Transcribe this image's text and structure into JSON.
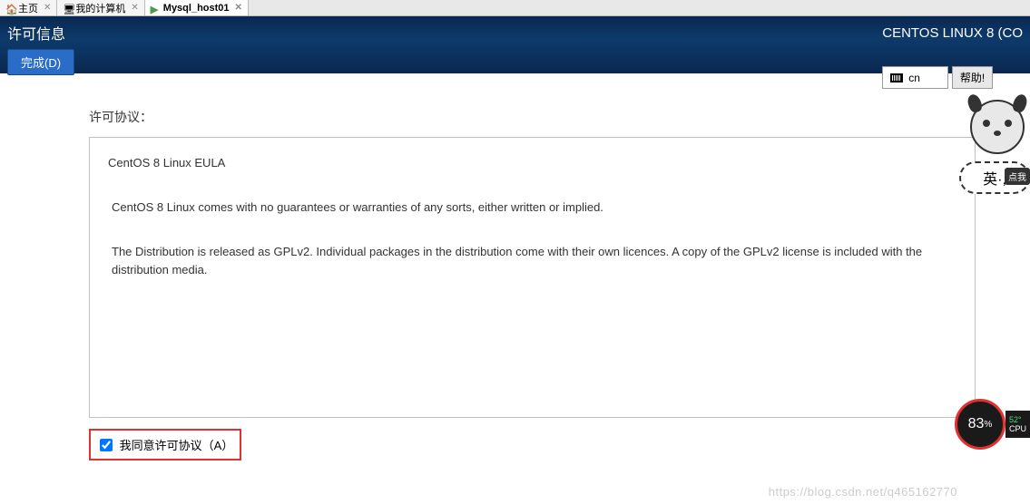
{
  "tabs": [
    {
      "icon": "home-icon",
      "label": "主页"
    },
    {
      "icon": "computer-icon",
      "label": "我的计算机"
    },
    {
      "icon": "server-icon",
      "label": "Mysql_host01",
      "active": true
    }
  ],
  "header": {
    "title": "许可信息",
    "done_label": "完成(D)",
    "os_title": "CENTOS LINUX 8 (CO",
    "lang_code": "cn",
    "help_label": "帮助!"
  },
  "content": {
    "section_label": "许可协议：",
    "eula_title": "CentOS 8 Linux EULA",
    "eula_p1": "CentOS 8 Linux comes with no guarantees or warranties of any sorts, either written or implied.",
    "eula_p2": "The Distribution is released as GPLv2. Individual packages in the distribution come with their own licences. A copy of the GPLv2 license is included with the distribution media.",
    "agree_label": "我同意许可协议（A）",
    "agree_checked": true
  },
  "mascot": {
    "bubble": "英·,",
    "tag": "点我"
  },
  "cpu": {
    "percent": "83",
    "pct_sym": "%",
    "temp": "52°",
    "label": "CPU"
  },
  "watermark": "https://blog.csdn.net/q465162770"
}
